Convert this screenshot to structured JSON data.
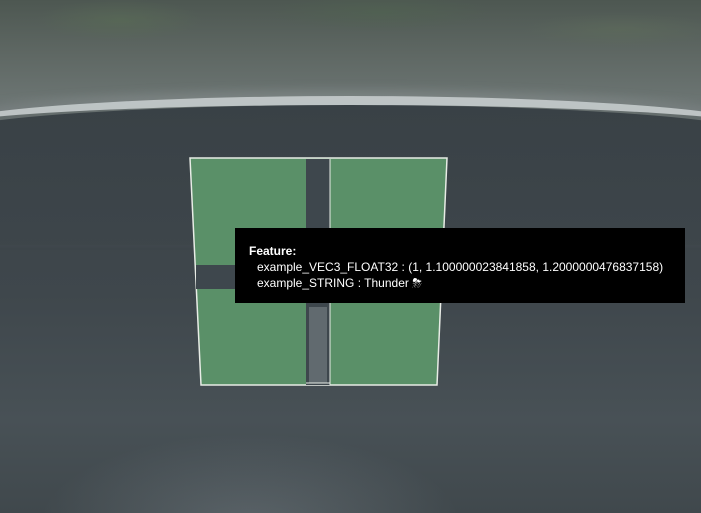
{
  "colors": {
    "feature_fill": "#5a9068",
    "feature_outline": "#e8ece6",
    "tooltip_bg": "#000000",
    "tooltip_text": "#ffffff"
  },
  "tooltip": {
    "title": "Feature:",
    "properties": [
      {
        "key": "example_VEC3_FLOAT32",
        "separator": " : ",
        "value": "(1, 1.100000023841858, 1.2000000476837158)"
      },
      {
        "key": "example_STRING",
        "separator": " : ",
        "value": "Thunder ⛈"
      }
    ]
  }
}
